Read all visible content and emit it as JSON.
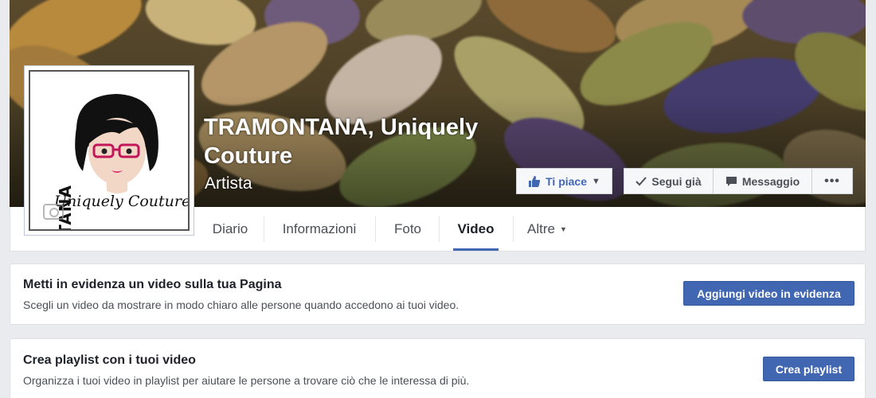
{
  "page": {
    "name": "TRAMONTANA, Uniquely Couture",
    "category": "Artista",
    "logo_vertical_text": "TRAMONTANA",
    "logo_script_text": "Uniquely Couture"
  },
  "actions": {
    "like_label": "Ti piace",
    "follow_label": "Segui già",
    "message_label": "Messaggio",
    "more_label": "•••"
  },
  "tabs": [
    {
      "label": "Diario"
    },
    {
      "label": "Informazioni"
    },
    {
      "label": "Foto"
    },
    {
      "label": "Video"
    },
    {
      "label": "Altre"
    }
  ],
  "featured_card": {
    "title": "Metti in evidenza un video sulla tua Pagina",
    "description": "Scegli un video da mostrare in modo chiaro alle persone quando accedono ai tuoi video.",
    "button_label": "Aggiungi video in evidenza"
  },
  "playlist_card": {
    "title": "Crea playlist con i tuoi video",
    "description": "Organizza i tuoi video in playlist per aiutare le persone a trovare ciò che le interessa di più.",
    "button_label": "Crea playlist"
  },
  "colors": {
    "facebook_blue": "#4267b2",
    "background": "#e9ebee",
    "text_dark": "#1d2129",
    "text_muted": "#4b4f56"
  },
  "icons": {
    "like": "thumbs-up-icon",
    "follow": "checkmark-icon",
    "message": "speech-bubble-icon",
    "more": "more-dots-icon",
    "dropdown": "caret-down-icon",
    "camera": "camera-icon"
  }
}
